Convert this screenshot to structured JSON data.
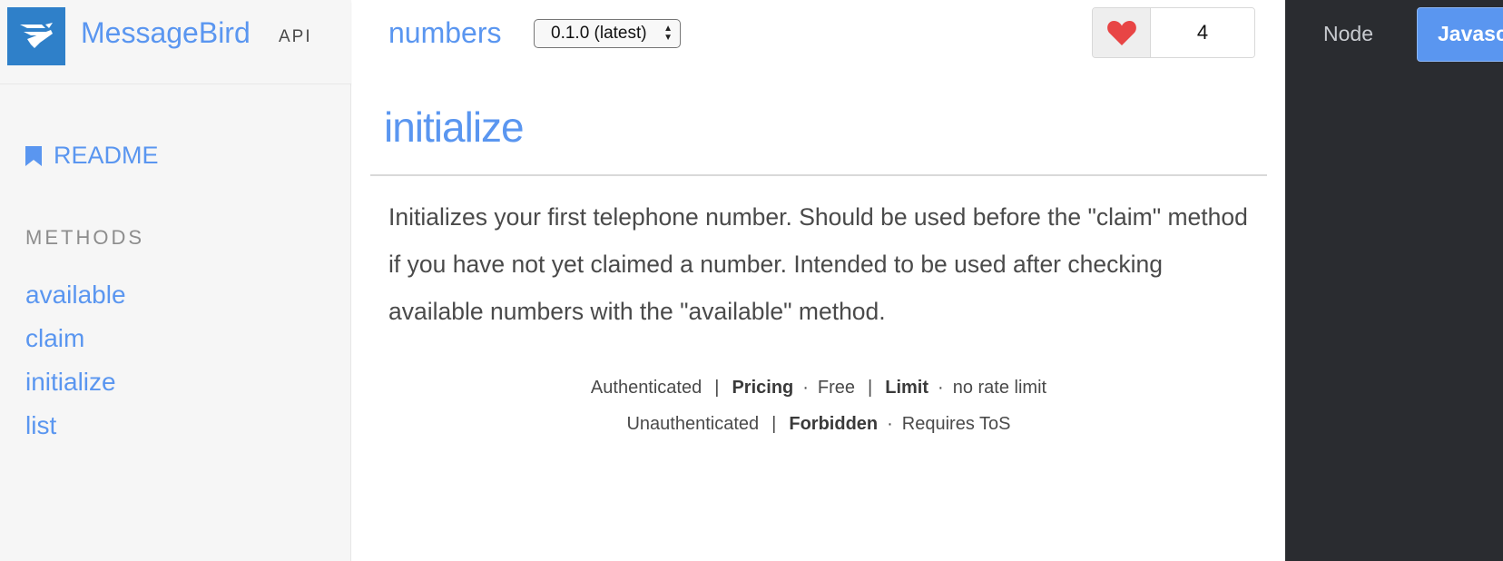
{
  "brand": {
    "name": "MessageBird",
    "tag": "API"
  },
  "sidebar": {
    "readme_label": "README",
    "methods_heading": "METHODS",
    "methods": [
      {
        "label": "available"
      },
      {
        "label": "claim"
      },
      {
        "label": "initialize"
      },
      {
        "label": "list"
      }
    ]
  },
  "header": {
    "service_name": "numbers",
    "version_selected": "0.1.0 (latest)",
    "like_count": "4"
  },
  "main": {
    "title": "initialize",
    "description": "Initializes your first telephone number. Should be used before the \"claim\" method if you have not yet claimed a number. Intended to be used after checking available numbers with the \"available\" method.",
    "meta_row1": {
      "auth_label": "Authenticated",
      "pricing_key": "Pricing",
      "pricing_value": "Free",
      "limit_key": "Limit",
      "limit_value": "no rate limit"
    },
    "meta_row2": {
      "auth_label": "Unauthenticated",
      "status_key": "Forbidden",
      "status_value": "Requires ToS"
    }
  },
  "code_panel": {
    "languages": [
      {
        "label": "Node"
      },
      {
        "label": "Javascript"
      }
    ]
  },
  "colors": {
    "accent": "#5a96f0",
    "logo_bg": "#2f80c9",
    "dark_panel": "#2a2c30",
    "heart": "#e84545"
  }
}
